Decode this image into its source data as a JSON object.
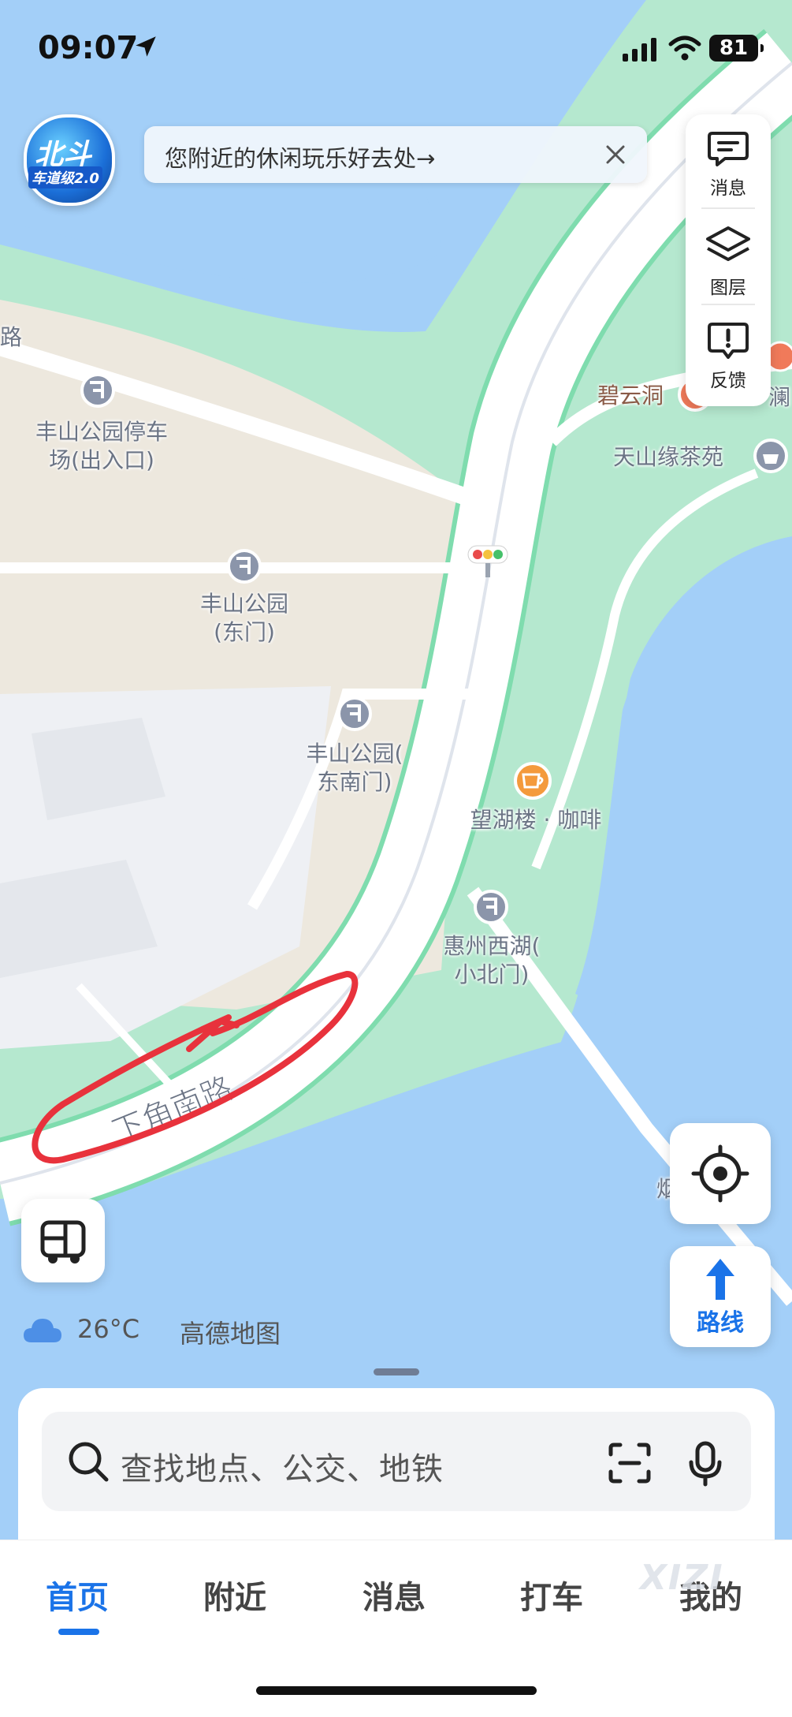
{
  "status_bar": {
    "time": "09:07",
    "battery": "81"
  },
  "badge": {
    "line1": "北斗",
    "line2": "车道级2.0"
  },
  "banner": {
    "text": "您附近的休闲玩乐好去处→"
  },
  "side_panel": {
    "items": [
      {
        "label": "消息",
        "icon": "message-icon"
      },
      {
        "label": "图层",
        "icon": "layers-icon"
      },
      {
        "label": "反馈",
        "icon": "feedback-icon"
      }
    ]
  },
  "map": {
    "road_label": "下角南路",
    "edge_labels": {
      "top_left": "路",
      "top_right": "澜",
      "bottom_right": "烟"
    },
    "pois": [
      {
        "name": "丰山公园停车场(出入口)",
        "line1": "丰山公园停车",
        "line2": "场(出入口)"
      },
      {
        "name": "丰山公园(东门)",
        "line1": "丰山公园",
        "line2": "(东门)"
      },
      {
        "name": "丰山公园(东南门)",
        "line1": "丰山公园(",
        "line2": "东南门)"
      },
      {
        "name": "望湖楼·咖啡",
        "line1": "望湖楼 · 咖啡"
      },
      {
        "name": "惠州西湖(小北门)",
        "line1": "惠州西湖(",
        "line2": "小北门)"
      },
      {
        "name": "碧云洞",
        "line1": "碧云洞"
      },
      {
        "name": "天山缘茶苑",
        "line1": "天山缘茶苑"
      }
    ]
  },
  "weather": {
    "temperature": "26°C",
    "brand": "高德地图"
  },
  "route_button": {
    "label": "路线"
  },
  "search": {
    "placeholder": "查找地点、公交、地铁"
  },
  "tabs": [
    {
      "label": "首页",
      "active": true
    },
    {
      "label": "附近",
      "active": false
    },
    {
      "label": "消息",
      "active": false
    },
    {
      "label": "打车",
      "active": false
    },
    {
      "label": "我的",
      "active": false
    }
  ],
  "watermark": "XIZI",
  "colors": {
    "water": "#a3cff8",
    "park": "#b5e8cf",
    "road": "#ffffff",
    "road_edge": "#7fdcae",
    "accent": "#1a73e8",
    "annotation": "#e8323c"
  }
}
